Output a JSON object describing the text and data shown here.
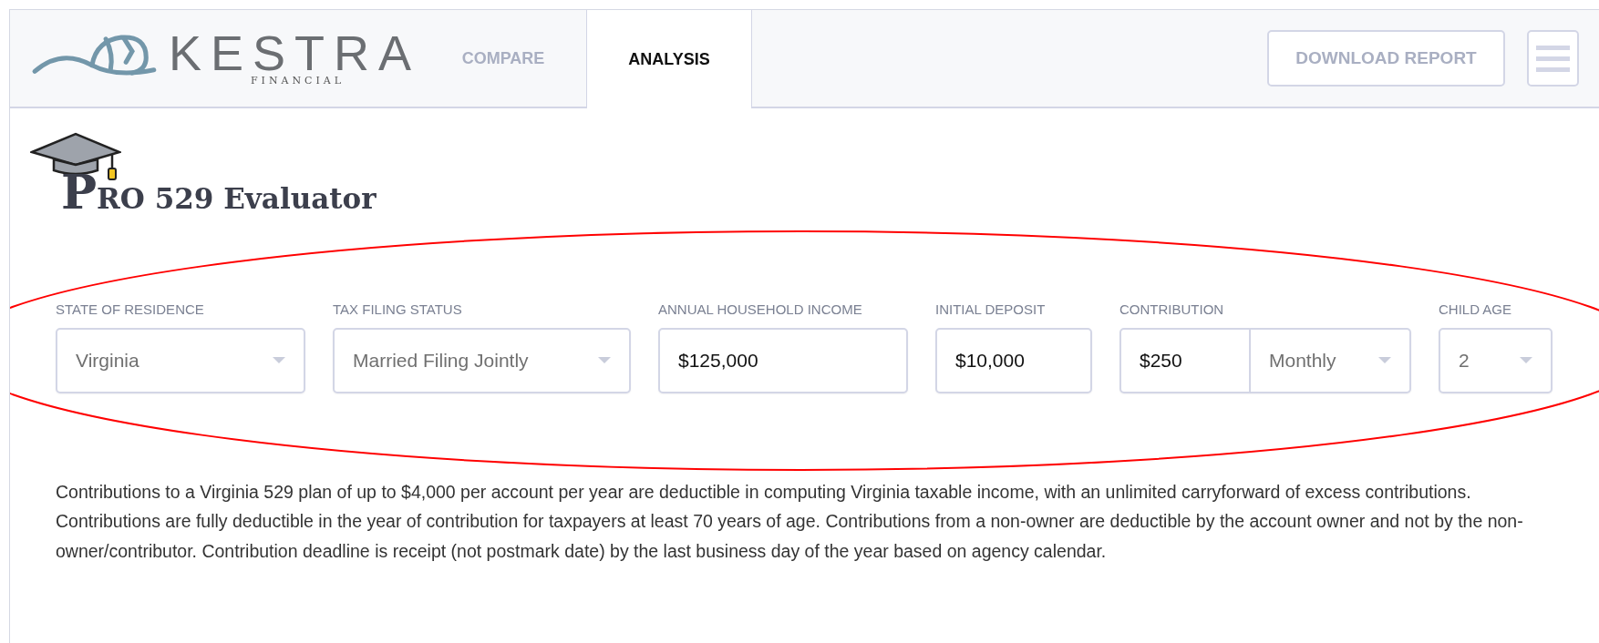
{
  "header": {
    "logo": {
      "name": "KESTRA",
      "tagline": "FINANCIAL"
    },
    "tabs": [
      {
        "label": "COMPARE",
        "selected": false
      },
      {
        "label": "ANALYSIS",
        "selected": true
      }
    ],
    "download_button": "DOWNLOAD REPORT"
  },
  "title": "PRO 529 Evaluator",
  "fields": [
    {
      "kind": "select",
      "label": "STATE OF RESIDENCE",
      "value": "Virginia"
    },
    {
      "kind": "select",
      "label": "TAX FILING STATUS",
      "value": "Married Filing Jointly"
    },
    {
      "kind": "input",
      "label": "ANNUAL HOUSEHOLD INCOME",
      "value": "$125,000"
    },
    {
      "kind": "input",
      "label": "INITIAL DEPOSIT",
      "value": "$10,000"
    },
    {
      "kind": "amount_period",
      "label": "CONTRIBUTION",
      "value": "$250",
      "period": "Monthly"
    },
    {
      "kind": "select",
      "label": "CHILD AGE",
      "value": "2"
    }
  ],
  "description": "Contributions to a Virginia 529 plan of up to $4,000 per account per year are deductible in computing Virginia taxable income, with an unlimited carryforward of excess contributions. Contributions are fully deductible in the year of contribution for taxpayers at least 70 years of age. Contributions from a non-owner are deductible by the account owner and not by the non-owner/contributor. Contribution deadline is receipt (not postmark date) by the last business day of the year based on agency calendar.",
  "annotation": {
    "kind": "ellipse",
    "color": "#ff0000"
  }
}
